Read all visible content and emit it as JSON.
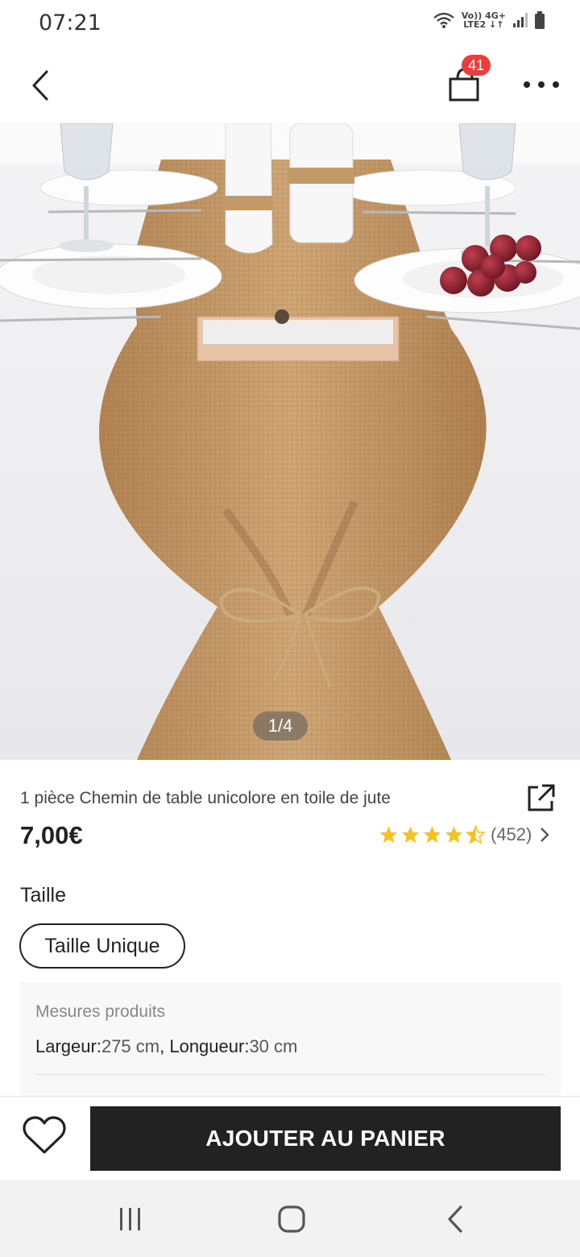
{
  "status_bar": {
    "time": "07:21",
    "network_top": "Vo)) 4G+",
    "network_bottom": "LTE2 ↓↑"
  },
  "header": {
    "back_icon": "chevron-left-icon",
    "cart_icon": "shopping-bag-icon",
    "cart_count": "41",
    "more_icon": "more-horizontal-icon"
  },
  "gallery": {
    "counter": "1/4",
    "description_icon": "product-photo"
  },
  "product": {
    "title": "1 pièce Chemin de table unicolore en toile de jute",
    "price": "7,00€",
    "rating": 4.5,
    "review_count": "(452)",
    "share_icon": "share-external-icon"
  },
  "size": {
    "label": "Taille",
    "selected_option": "Taille Unique"
  },
  "measurements": {
    "title": "Mesures produits",
    "width_key": "Largeur:",
    "width_value": "275 cm",
    "separator": ", ",
    "length_key": "Longueur:",
    "length_value": "30 cm"
  },
  "actions": {
    "wishlist_icon": "heart-icon",
    "add_to_cart_label": "AJOUTER AU PANIER"
  },
  "system_nav": {
    "recent_icon": "recent-apps-icon",
    "home_icon": "home-icon",
    "back_icon": "back-icon"
  },
  "colors": {
    "badge": "#f23a3a",
    "star": "#f7c21b",
    "primary_button": "#222222",
    "burlap": "#c49a6c"
  }
}
